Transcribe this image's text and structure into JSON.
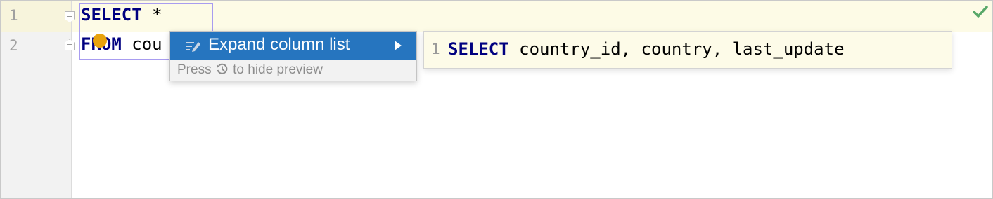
{
  "editor": {
    "lines": [
      {
        "number": "1",
        "keyword": "SELECT",
        "rest": " *"
      },
      {
        "number": "2",
        "keyword": "FROM",
        "rest": " cou"
      }
    ]
  },
  "status": {
    "icon": "checkmark-icon",
    "color": "#59a869"
  },
  "context_menu": {
    "item_label": "Expand column list",
    "item_icon": "intention-icon",
    "hint_prefix": "Press ",
    "hint_icon": "undo-arrow-icon",
    "hint_suffix": " to hide preview"
  },
  "preview": {
    "line_number": "1",
    "keyword": "SELECT",
    "rest": " country_id, country, last_update"
  },
  "colors": {
    "accent": "#2675bf",
    "keyword": "#000080",
    "bulb": "#e8a20c",
    "current_line": "#fdfbe6"
  }
}
